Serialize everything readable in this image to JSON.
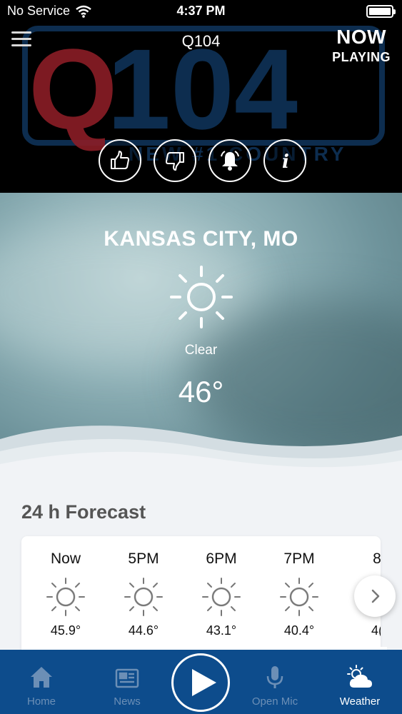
{
  "status_bar": {
    "carrier": "No Service",
    "time": "4:37 PM"
  },
  "header": {
    "station": "Q104",
    "now_playing_line1": "NOW",
    "now_playing_line2": "PLAYING",
    "logo_text": "Q104",
    "logo_tagline": "NEW #1 COUNTRY",
    "actions": [
      "thumbs-up-icon",
      "thumbs-down-icon",
      "bell-icon",
      "info-icon"
    ]
  },
  "weather": {
    "city": "KANSAS CITY, MO",
    "condition": "Clear",
    "temperature": "46°",
    "icon": "sun-icon"
  },
  "forecast": {
    "title": "24 h Forecast",
    "hours": [
      {
        "label": "Now",
        "temp": "45.9°"
      },
      {
        "label": "5PM",
        "temp": "44.6°"
      },
      {
        "label": "6PM",
        "temp": "43.1°"
      },
      {
        "label": "7PM",
        "temp": "40.4°"
      },
      {
        "label": "8",
        "temp": "4("
      }
    ]
  },
  "nav": {
    "items": [
      {
        "label": "Home",
        "icon": "home-icon"
      },
      {
        "label": "News",
        "icon": "newspaper-icon"
      },
      {
        "label": "Open Mic",
        "icon": "microphone-icon"
      },
      {
        "label": "Weather",
        "icon": "weather-icon"
      }
    ],
    "active": "Weather"
  },
  "colors": {
    "nav_bg": "#0d4c8c",
    "nav_inactive": "#6c8fb6",
    "logo_red": "#8b1d26",
    "logo_blue": "#0d2d4f"
  }
}
